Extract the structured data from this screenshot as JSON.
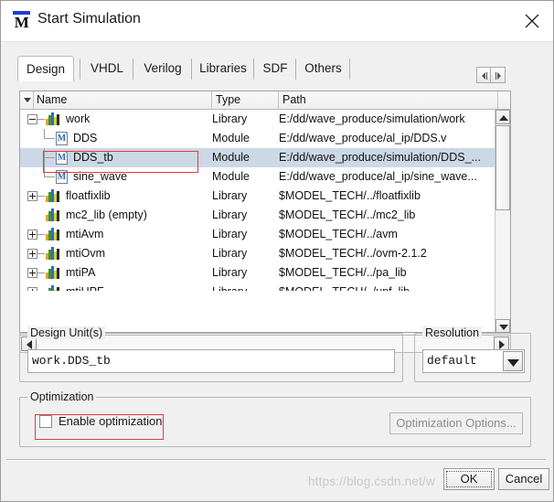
{
  "window": {
    "title": "Start Simulation",
    "icon": "modelsim-m-icon",
    "close_label": "×"
  },
  "tabs": {
    "items": [
      {
        "label": "Design",
        "active": true
      },
      {
        "label": "VHDL",
        "active": false
      },
      {
        "label": "Verilog",
        "active": false
      },
      {
        "label": "Libraries",
        "active": false
      },
      {
        "label": "SDF",
        "active": false
      },
      {
        "label": "Others",
        "active": false
      }
    ],
    "scroll_left_icon": "chevron-left-icon",
    "scroll_right_icon": "chevron-right-icon"
  },
  "tree": {
    "columns": [
      "Name",
      "Type",
      "Path"
    ],
    "rows": [
      {
        "name": "work",
        "type": "Library",
        "path": "E:/dd/wave_produce/simulation/work",
        "depth": 0,
        "icon": "library-icon",
        "expander": "minus",
        "selected": false
      },
      {
        "name": "DDS",
        "type": "Module",
        "path": "E:/dd/wave_produce/al_ip/DDS.v",
        "depth": 1,
        "icon": "module-icon",
        "expander": "none",
        "selected": false
      },
      {
        "name": "DDS_tb",
        "type": "Module",
        "path": "E:/dd/wave_produce/simulation/DDS_...",
        "depth": 1,
        "icon": "module-icon",
        "expander": "none",
        "selected": true
      },
      {
        "name": "sine_wave",
        "type": "Module",
        "path": "E:/dd/wave_produce/al_ip/sine_wave...",
        "depth": 1,
        "icon": "module-icon",
        "expander": "none",
        "selected": false
      },
      {
        "name": "floatfixlib",
        "type": "Library",
        "path": "$MODEL_TECH/../floatfixlib",
        "depth": 0,
        "icon": "library-icon",
        "expander": "plus",
        "selected": false
      },
      {
        "name": "mc2_lib  (empty)",
        "type": "Library",
        "path": "$MODEL_TECH/../mc2_lib",
        "depth": 0,
        "icon": "library-icon",
        "expander": "none",
        "selected": false
      },
      {
        "name": "mtiAvm",
        "type": "Library",
        "path": "$MODEL_TECH/../avm",
        "depth": 0,
        "icon": "library-icon",
        "expander": "plus",
        "selected": false
      },
      {
        "name": "mtiOvm",
        "type": "Library",
        "path": "$MODEL_TECH/../ovm-2.1.2",
        "depth": 0,
        "icon": "library-icon",
        "expander": "plus",
        "selected": false
      },
      {
        "name": "mtiPA",
        "type": "Library",
        "path": "$MODEL_TECH/../pa_lib",
        "depth": 0,
        "icon": "library-icon",
        "expander": "plus",
        "selected": false
      },
      {
        "name": "mtiUPF",
        "type": "Library",
        "path": "$MODEL_TECH/../upf_lib",
        "depth": 0,
        "icon": "library-icon",
        "expander": "plus",
        "selected": false
      }
    ],
    "vscroll": {
      "up_icon": "scroll-up-icon",
      "down_icon": "scroll-down-icon"
    },
    "hscroll": {
      "left_icon": "scroll-left-icon",
      "right_icon": "scroll-right-icon"
    }
  },
  "design_units": {
    "title": "Design Unit(s)",
    "value": "work.DDS_tb"
  },
  "resolution": {
    "title": "Resolution",
    "value": "default",
    "arrow_icon": "chevron-down-icon"
  },
  "optimization": {
    "title": "Optimization",
    "checkbox_label": "Enable optimization",
    "checked": false,
    "options_button": "Optimization Options...",
    "options_enabled": false
  },
  "footer": {
    "ok_label": "OK",
    "cancel_label": "Cancel",
    "watermark": "https://blog.csdn.net/w"
  },
  "colors": {
    "selection": "#ccd8e5",
    "annotation": "#e33b3b",
    "dialog_bg": "#f0f0f0",
    "accent": "#1c3fd6"
  }
}
